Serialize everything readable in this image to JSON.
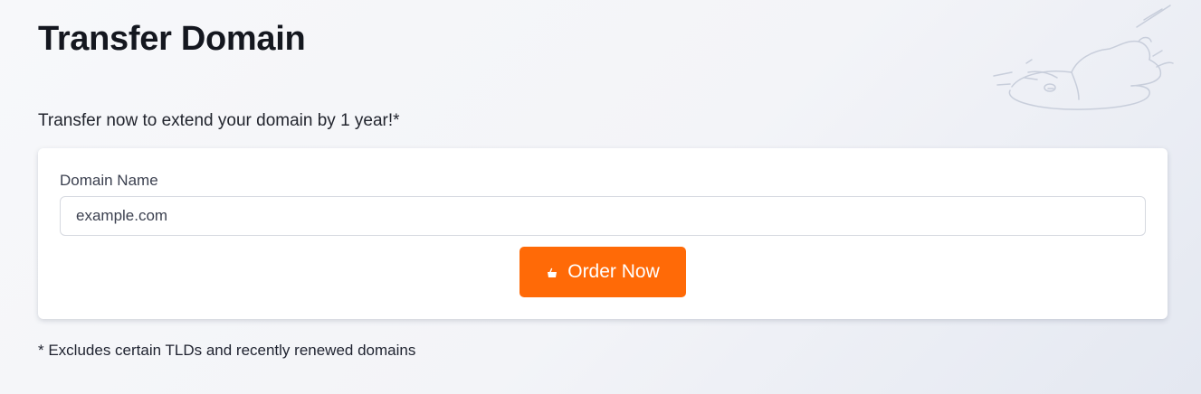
{
  "page": {
    "title": "Transfer Domain",
    "subtitle": "Transfer now to extend your domain by 1 year!*"
  },
  "form": {
    "domain_label": "Domain Name",
    "domain_placeholder": "example.com",
    "order_button_label": "Order Now",
    "order_button_icon": "cart-icon"
  },
  "footnote": "* Excludes certain TLDs and recently renewed domains",
  "colors": {
    "accent": "#ff6a07",
    "background": "#f3f4f8",
    "card": "#ffffff"
  }
}
